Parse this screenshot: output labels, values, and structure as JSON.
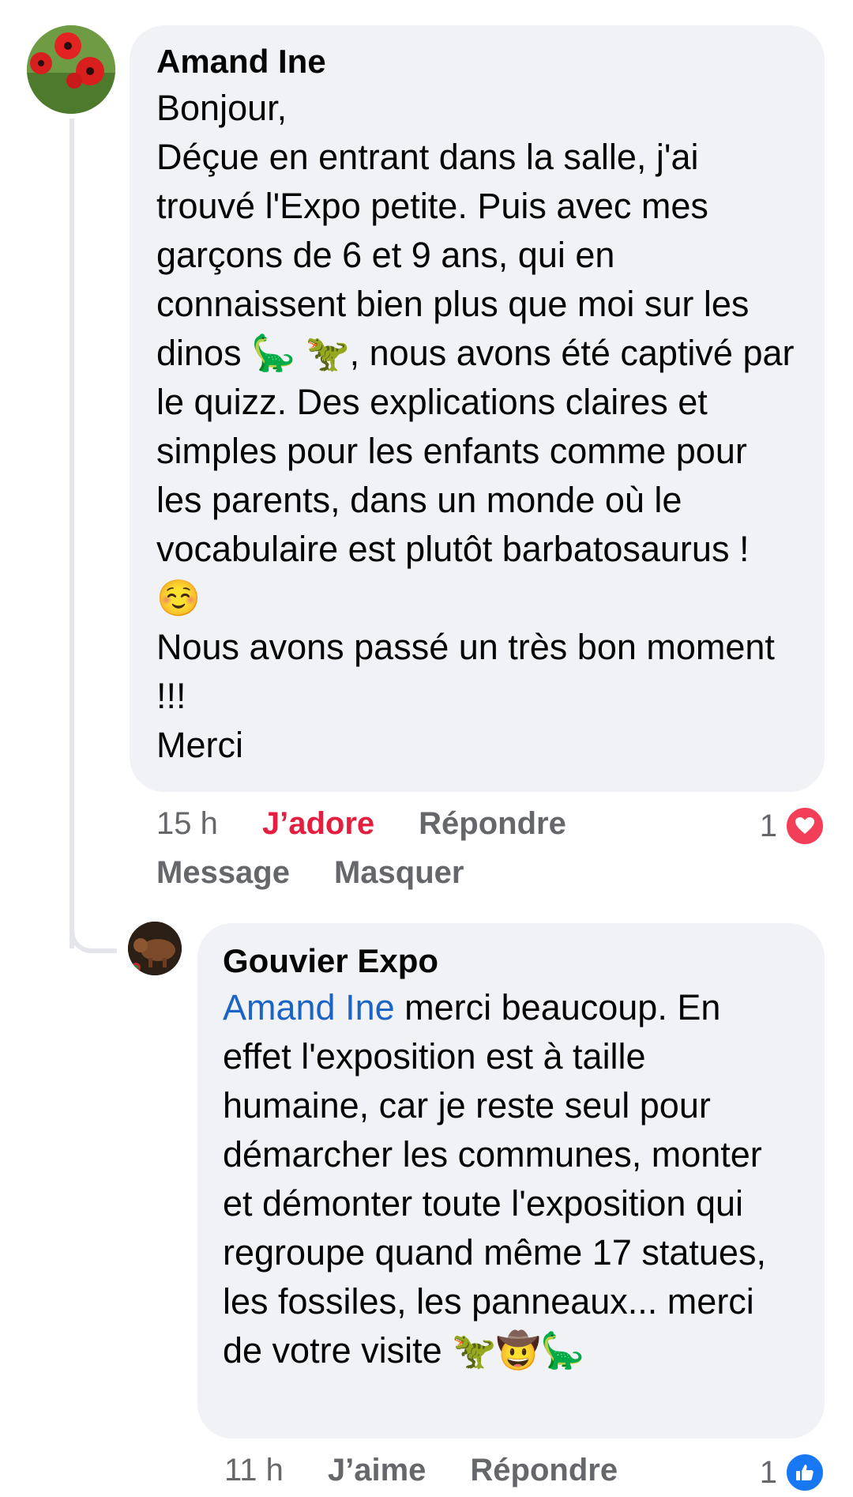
{
  "comments": [
    {
      "author": "Amand Ine",
      "text": "Bonjour,\nDéçue en entrant dans la salle, j'ai trouvé l'Expo petite. Puis avec mes garçons de 6 et 9 ans, qui en connaissent bien plus que moi sur les dinos 🦕 🦖, nous avons été captivé par le quizz. Des explications claires et simples pour les enfants comme pour les parents, dans un monde où le vocabulaire est plutôt barbatosaurus ! ☺️\nNous avons passé un très bon moment !!!\nMerci",
      "time": "15 h",
      "reaction_action": "J’adore",
      "reply": "Répondre",
      "message": "Message",
      "hide": "Masquer",
      "reaction_count": "1",
      "reaction_icon": "heart-icon"
    },
    {
      "author": "Gouvier Expo",
      "mention": "Amand Ine",
      "text": " merci beaucoup. En effet l'exposition est à taille humaine, car je reste seul pour démarcher les communes, monter et démonter toute l'exposition qui regroupe quand même 17 statues, les fossiles, les panneaux... merci de votre visite 🦖🤠🦕",
      "time": "11 h",
      "reaction_action": "J’aime",
      "reply": "Répondre",
      "reaction_count": "1",
      "reaction_icon": "thumbs-up-icon"
    }
  ],
  "colors": {
    "bubble": "#f0f2f5",
    "meta": "#65676b",
    "love": "#e41e3f",
    "mention": "#1b64c4",
    "like": "#1877f2"
  }
}
